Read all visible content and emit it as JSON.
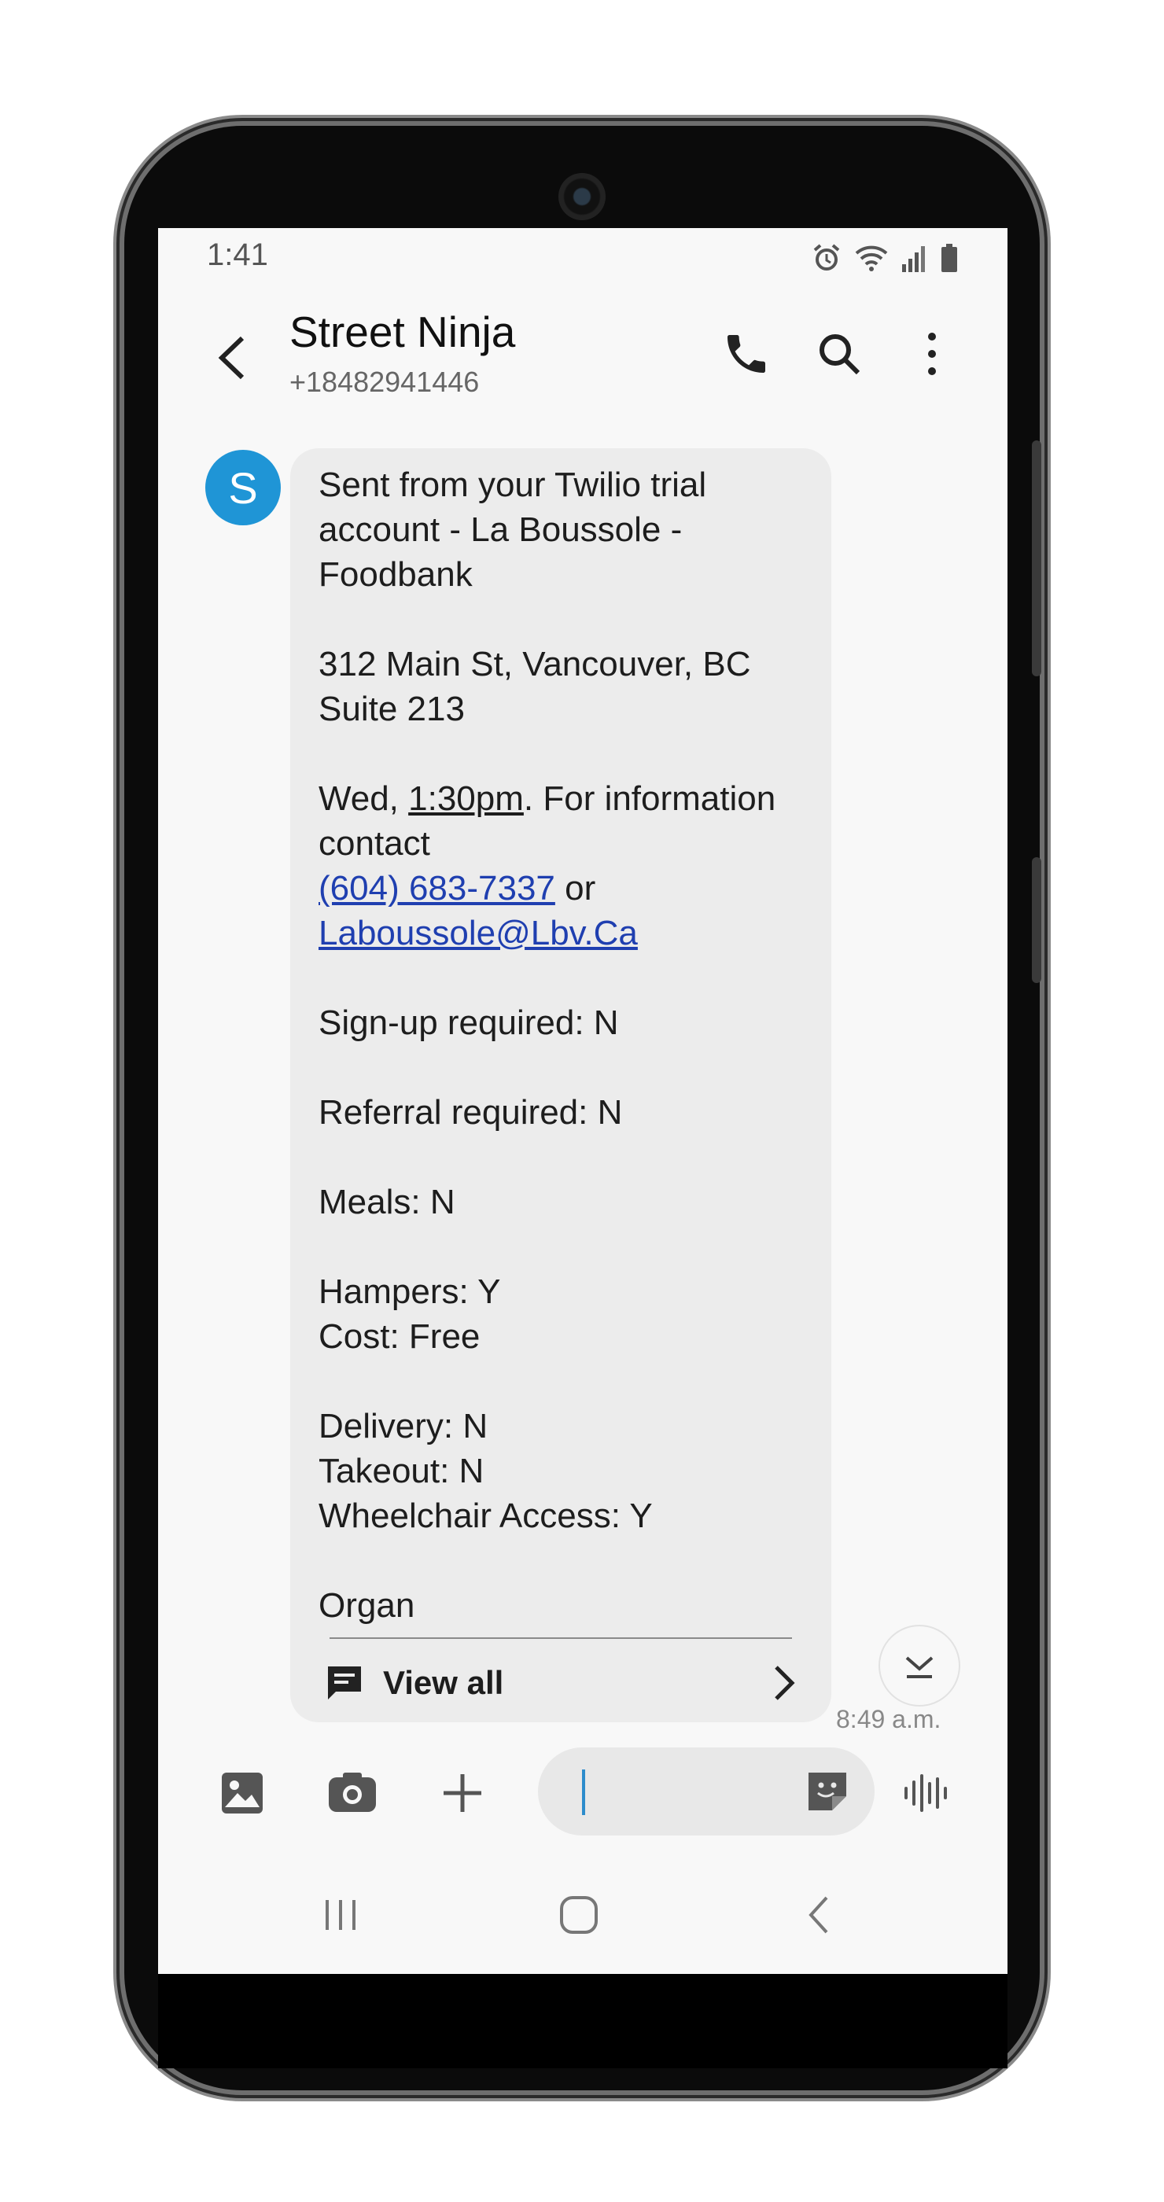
{
  "status_bar": {
    "time": "1:41"
  },
  "header": {
    "contact_name": "Street Ninja",
    "contact_number": "+18482941446"
  },
  "conversation": {
    "avatar_initial": "S",
    "message": {
      "line1": "Sent from your Twilio trial account - La Boussole - Foodbank\n\n312 Main St, Vancouver, BC Suite 213\n\nWed, ",
      "time_link": "1:30pm",
      "line2": ". For information contact\n",
      "phone_link": "(604) 683-7337",
      "or_text": " or\n",
      "email_link": "Laboussole@Lbv.Ca",
      "line3": "\n\nSign-up required: N\n\nReferral required: N\n\nMeals: N\n\nHampers: Y\nCost: Free\n\nDelivery: N\nTakeout: N\nWheelchair Access: Y\n\nOrgan"
    },
    "view_all_label": "View all",
    "timestamp": "8:49 a.m."
  },
  "composer": {
    "input_value": "",
    "accent_color": "#2d8ccc"
  },
  "icons": {
    "status": [
      "alarm-icon",
      "wifi-icon",
      "signal-icon",
      "battery-icon"
    ],
    "header": [
      "back-arrow-icon",
      "phone-icon",
      "search-icon",
      "more-vert-icon"
    ],
    "composer": [
      "gallery-icon",
      "camera-icon",
      "plus-icon",
      "sticker-icon",
      "voice-icon"
    ],
    "nav": [
      "recents-icon",
      "home-icon",
      "back-icon"
    ]
  },
  "colors": {
    "avatar": "#1f95d6",
    "bubble": "#ececec",
    "link": "#1f3fb0"
  }
}
